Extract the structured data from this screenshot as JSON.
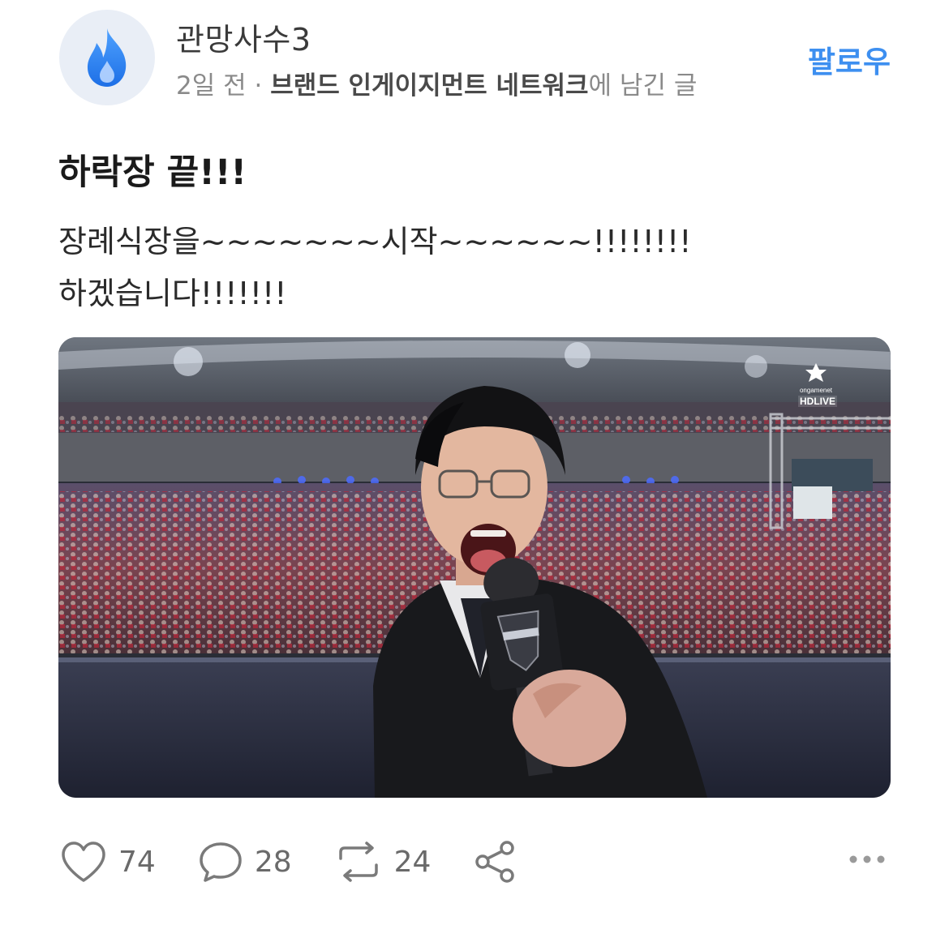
{
  "header": {
    "avatar_icon": "flame-droplet-icon",
    "author": "관망사수3",
    "time": "2일 전",
    "separator": " · ",
    "channel": "브랜드 인게이지먼트 네트워크",
    "suffix": "에 남긴 글",
    "follow_label": "팔로우"
  },
  "post": {
    "title": "하락장 끝!!!",
    "body": "장례식장을~~~~~~~시작~~~~~~!!!!!!!!\n하겠습니다!!!!!!!"
  },
  "media": {
    "overlay_brand": "ongamenet",
    "overlay_live": "HDLIVE"
  },
  "actions": {
    "likes": "74",
    "comments": "28",
    "reposts": "24",
    "share_icon": "share-icon",
    "more_icon": "more-dots-icon"
  },
  "colors": {
    "accent": "#3d8ff0",
    "muted": "#8a8a8a",
    "avatar_bg": "#e9eef6"
  }
}
